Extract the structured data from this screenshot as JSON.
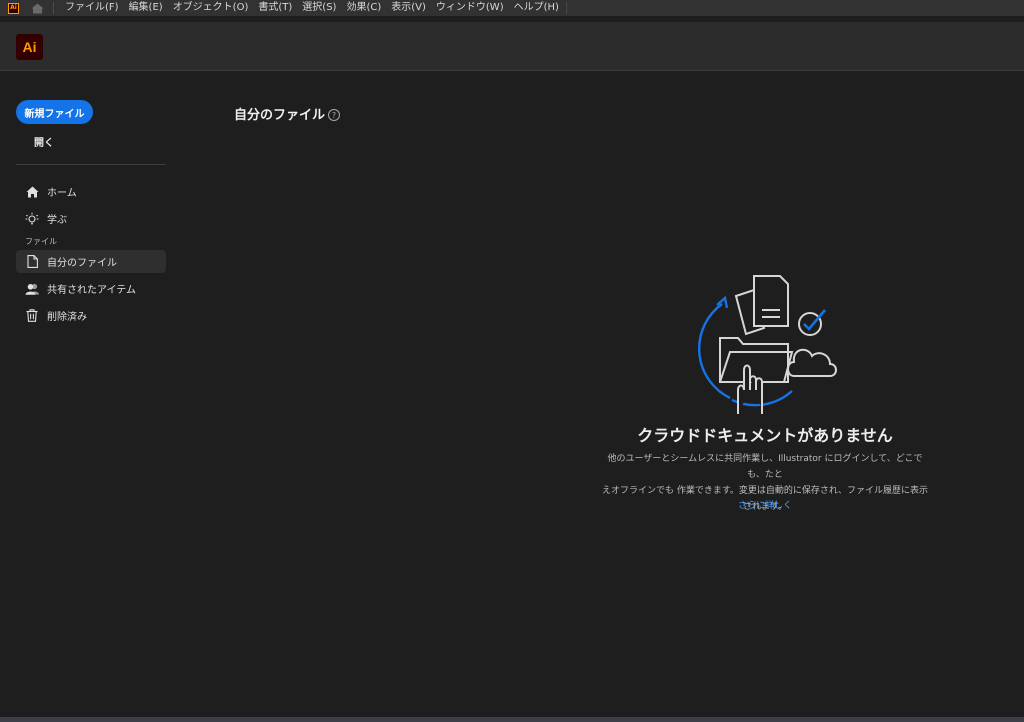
{
  "menubar": {
    "app_icon_text": "Ai",
    "items": [
      "ファイル(F)",
      "編集(E)",
      "オブジェクト(O)",
      "書式(T)",
      "選択(S)",
      "効果(C)",
      "表示(V)",
      "ウィンドウ(W)",
      "ヘルプ(H)"
    ]
  },
  "appbar": {
    "logo_text": "Ai",
    "brand_color": "#ff9a00",
    "logo_bg": "#330000"
  },
  "sidebar": {
    "new_file_label": "新規ファイル",
    "open_label": "開く",
    "section_files_label": "ファイル",
    "items": [
      {
        "label": "ホーム",
        "icon": "home-icon"
      },
      {
        "label": "学ぶ",
        "icon": "lightbulb-icon"
      },
      {
        "label": "自分のファイル",
        "icon": "document-icon",
        "active": true
      },
      {
        "label": "共有されたアイテム",
        "icon": "shared-users-icon"
      },
      {
        "label": "削除済み",
        "icon": "trash-icon"
      }
    ]
  },
  "main": {
    "title": "自分のファイル",
    "help_glyph": "?",
    "empty_state": {
      "title": "クラウドドキュメントがありません",
      "description_line1": "他のユーザーとシームレスに共同作業し、Illustrator にログインして、どこでも、たと",
      "description_line2": "えオフラインでも 作業できます。変更は自動的に保存され、ファイル履歴に表示",
      "description_line3": "されます。",
      "link": "さらに詳しく"
    }
  },
  "colors": {
    "accent": "#1473e6",
    "link": "#4ba1ff",
    "background": "#1e1e1e",
    "header": "#2c2c2c"
  }
}
